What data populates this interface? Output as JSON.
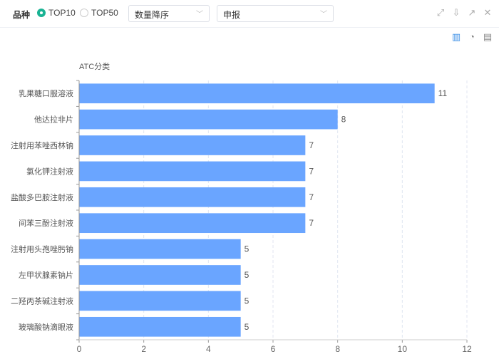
{
  "toolbar": {
    "label": "品种",
    "radio_options": [
      "TOP10",
      "TOP50"
    ],
    "selected": "TOP10",
    "sort_select": "数量降序",
    "type_select": "申报"
  },
  "icons": {
    "window": [
      "expand-icon",
      "download-icon",
      "external-link-icon",
      "close-icon"
    ],
    "view": [
      "bar-chart-icon",
      "pie-chart-icon",
      "table-icon"
    ]
  },
  "chart_data": {
    "type": "bar",
    "orientation": "horizontal",
    "ylabel": "ATC分类",
    "xlabel": "",
    "categories": [
      "乳果糖口服溶液",
      "他达拉非片",
      "注射用苯唑西林钠",
      "氯化钾注射液",
      "盐酸多巴胺注射液",
      "间苯三酚注射液",
      "注射用头孢唑肟钠",
      "左甲状腺素钠片",
      "二羟丙茶碱注射液",
      "玻璃酸钠滴眼液"
    ],
    "values": [
      11,
      8,
      7,
      7,
      7,
      7,
      5,
      5,
      5,
      5
    ],
    "xlim": [
      0,
      12
    ],
    "xticks": [
      0,
      2,
      4,
      6,
      8,
      10,
      12
    ],
    "bar_color": "#6aa5ff",
    "grid": true
  }
}
